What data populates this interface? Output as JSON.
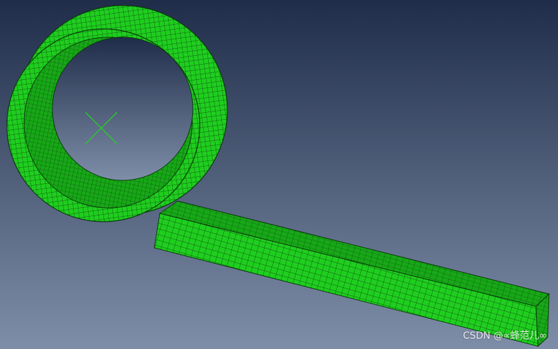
{
  "viewport": {
    "background_top": "#1f2d4a",
    "background_bottom": "#7f8ea8",
    "mesh_fill": "#1fce1f",
    "mesh_fill_dark": "#17a817",
    "mesh_line": "#0a3a0a",
    "reference_point_color": "#27d127"
  },
  "watermark": {
    "text": "CSDN @∝蜂范儿∞"
  }
}
